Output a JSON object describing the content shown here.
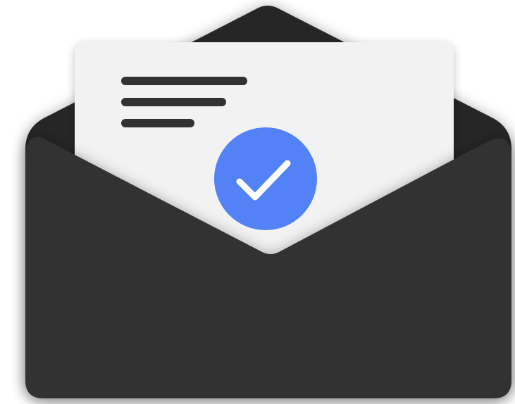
{
  "illustration": {
    "icon": "open-envelope-with-verified-letter-icon",
    "parts": {
      "envelope": "envelope-icon",
      "letter": "letter-icon",
      "badge": "check-badge-icon"
    },
    "colors": {
      "envelope_body": "#333333",
      "envelope_flap": "#262626",
      "envelope_inner": "#2b2b2b",
      "letter_paper": "#f2f2f2",
      "text_lines": "#333333",
      "badge_fill": "#5282f6",
      "checkmark": "#ffffff",
      "background": "#ffffff"
    },
    "letter_text_lines": 3
  }
}
